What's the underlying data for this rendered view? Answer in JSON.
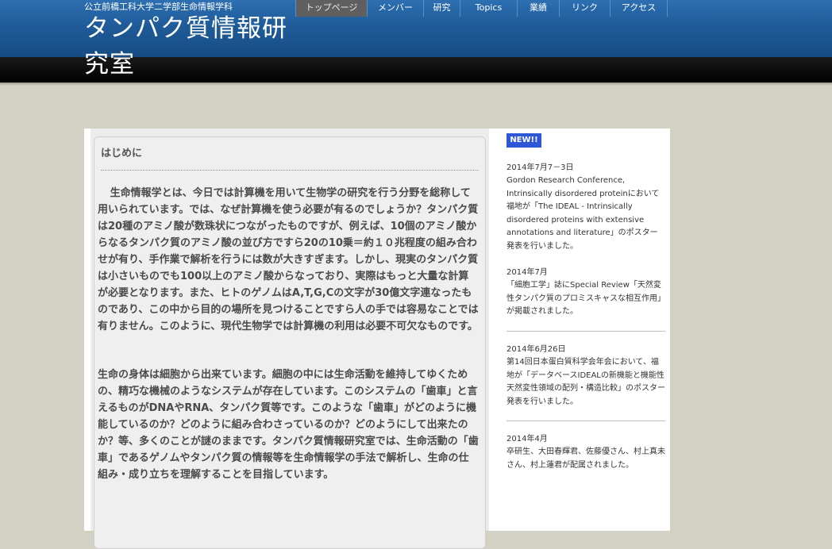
{
  "header": {
    "subtitle": "公立前橋工科大学二学部生命情報学科",
    "title": "タンパク質情報研究室"
  },
  "nav": {
    "items": [
      {
        "label": "トップページ",
        "active": true
      },
      {
        "label": "メンバー",
        "active": false
      },
      {
        "label": "研究",
        "active": false
      },
      {
        "label": "Topics",
        "active": false
      },
      {
        "label": "業績",
        "active": false
      },
      {
        "label": "リンク",
        "active": false
      },
      {
        "label": "アクセス",
        "active": false
      }
    ]
  },
  "main": {
    "section_title": "はじめに",
    "paragraphs": [
      "生命情報学とは、今日では計算機を用いて生物学の研究を行う分野を総称して用いられています。では、なぜ計算機を使う必要が有るのでしょうか？タンパク質は20種のアミノ酸が数珠状につながったものですが、例えば、10個のアミノ酸からなるタンパク質のアミノ酸の並び方ですら20の10乗＝約１０兆程度の組み合わせが有り、手作業で解析を行うには数が大きすぎます。しかし、現実のタンパク質は小さいものでも100以上のアミノ酸からなっており、実際はもっと大量な計算が必要となります。また、ヒトのゲノムはA,T,G,Cの文字が30億文字連なったものであり、この中から目的の場所を見つけることですら人の手では容易なことでは有りません。このように、現代生物学では計算機の利用は必要不可欠なものです。",
      "生命の身体は細胞から出来ています。細胞の中には生命活動を維持してゆくための、精巧な機械のようなシステムが存在しています。このシステムの「歯車」と言えるものがDNAやRNA、タンパク質等です。このような「歯車」がどのように機能しているのか？どのように組み合わさっているのか？どのようにして出来たのか？等、多くのことが謎のままです。タンパク質情報研究室では、生命活動の「歯車」であるゲノムやタンパク質の情報等を生命情報学の手法で解析し、生命の仕組み・成り立ちを理解することを目指しています。"
    ]
  },
  "sidebar": {
    "badge": "NEW!!",
    "news": [
      {
        "date": "2014年7月7－3日",
        "text": "Gordon Research Conference, Intrinsically disordered proteinにおいて福地が「The IDEAL - Intrinsically disordered proteins with extensive annotations and literature」のポスター発表を行いました。"
      },
      {
        "date": "2014年7月",
        "text": "「細胞工学」誌にSpecial Review「天然変性タンパク質のプロミスキャスな相互作用」が掲載されました。"
      },
      {
        "date": "2014年6月26日",
        "text": "第14回日本蛋白質科学会年会において、福地が「データベースIDEALの新機能と機能性天然変性領域の配列・構造比較」のポスター発表を行いました。"
      },
      {
        "date": "2014年4月",
        "text": "卒研生、大田春輝君、佐藤優さん、村上真未さん、村上蓮君が配属されました。"
      }
    ]
  }
}
